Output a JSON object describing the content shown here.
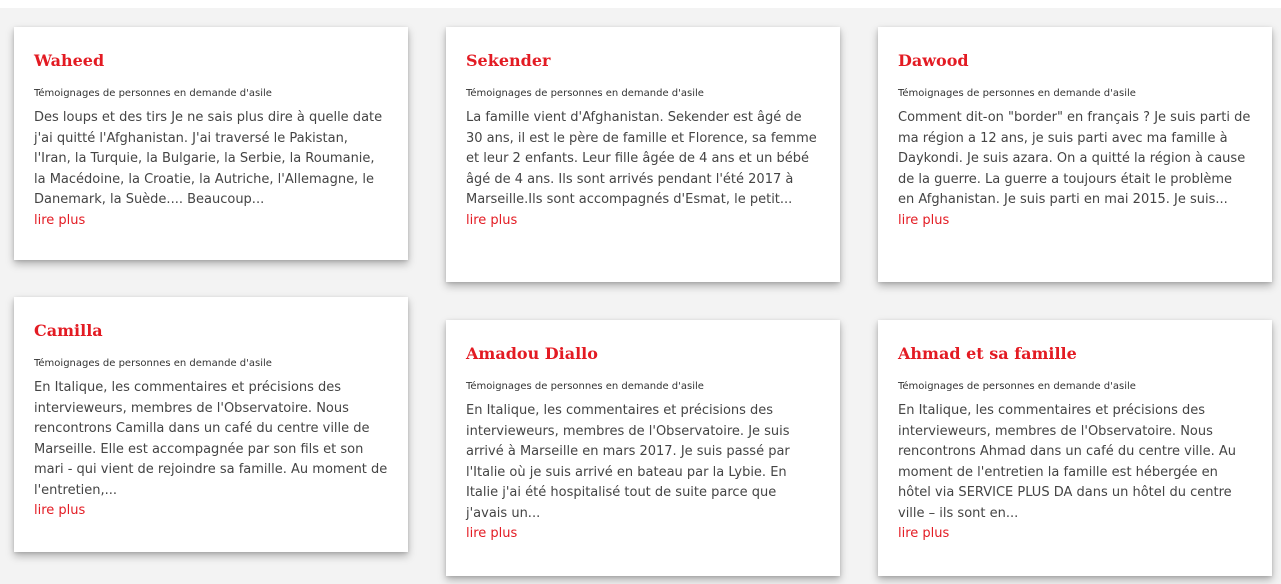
{
  "colors": {
    "accent": "#e31b23",
    "text": "#444444",
    "background": "#f3f3f3",
    "card": "#ffffff"
  },
  "cards": [
    {
      "title": "Waheed",
      "category": "Témoignages de personnes en demande d'asile",
      "excerpt": "Des loups et des tirs Je ne sais plus dire à quelle date j'ai quitté l'Afghanistan. J'ai traversé le Pakistan, l'Iran, la Turquie, la Bulgarie, la Serbie, la Roumanie, la Macédoine, la Croatie, la Autriche, l'Allemagne, le Danemark, la Suède.... Beaucoup...",
      "more": "lire plus"
    },
    {
      "title": "Sekender",
      "category": "Témoignages de personnes en demande d'asile",
      "excerpt": "La famille vient d'Afghanistan. Sekender est âgé de 30 ans, il est le père de famille et Florence, sa femme et leur 2 enfants. Leur fille âgée de 4 ans et un bébé âgé de 4 ans. Ils sont arrivés pendant l'été 2017 à Marseille.Ils sont accompagnés d'Esmat, le petit...",
      "more": "lire plus"
    },
    {
      "title": "Dawood",
      "category": "Témoignages de personnes en demande d'asile",
      "excerpt": "Comment dit-on \"border\" en français ? Je suis parti de ma région a 12 ans, je suis parti avec ma famille à Daykondi. Je suis azara. On a quitté la région à cause de la guerre. La guerre a toujours était le problème en Afghanistan. Je suis parti en mai 2015. Je suis...",
      "more": "lire plus"
    },
    {
      "title": "Camilla",
      "category": "Témoignages de personnes en demande d'asile",
      "excerpt": "En Italique, les commentaires et précisions des intervieweurs, membres de l'Observatoire. Nous rencontrons Camilla dans un café du centre ville de Marseille. Elle est accompagnée par son fils et son mari - qui vient de rejoindre sa famille. Au moment de l'entretien,...",
      "more": "lire plus"
    },
    {
      "title": "Amadou Diallo",
      "category": "Témoignages de personnes en demande d'asile",
      "excerpt": "En Italique, les commentaires et précisions des intervieweurs, membres de l'Observatoire. Je suis arrivé à Marseille en mars 2017. Je suis passé par l'Italie où je suis arrivé en bateau par la Lybie. En Italie j'ai été hospitalisé tout de suite parce que j'avais un...",
      "more": "lire plus"
    },
    {
      "title": "Ahmad et sa famille",
      "category": "Témoignages de personnes en demande d'asile",
      "excerpt": "En Italique, les commentaires et précisions des intervieweurs, membres de l'Observatoire. Nous rencontrons Ahmad dans un café du centre ville. Au moment de l'entretien la famille est hébergée en hôtel via SERVICE PLUS DA dans un hôtel du centre ville – ils sont en...",
      "more": "lire plus"
    }
  ]
}
